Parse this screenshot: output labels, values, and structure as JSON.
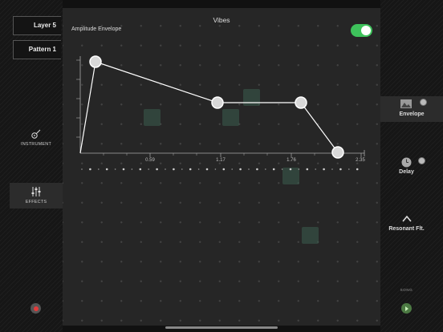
{
  "left": {
    "layer_label": "Layer 5",
    "pattern_label": "Pattern 1",
    "instrument_label": "INSTRUMENT",
    "effects_label": "EFFECTS"
  },
  "main": {
    "title": "Vibes",
    "subtitle": "Amplitude Envelope",
    "toggle_on": true,
    "x_ticks": [
      "0.59",
      "1.17",
      "1.76",
      "2.35"
    ]
  },
  "right": {
    "envelope_label": "Envelope",
    "delay_label": "Delay",
    "resonant_label": "Resonant Flt.",
    "song_label": "SONG"
  },
  "colors": {
    "accent_green": "#3ec25b",
    "record_red": "#e23b3b",
    "play_green": "#4c7a43"
  }
}
